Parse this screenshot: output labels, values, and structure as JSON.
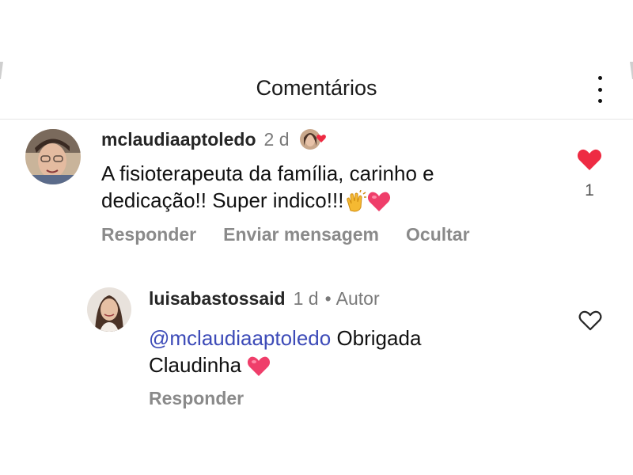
{
  "header": {
    "title": "Comentários",
    "more_icon": "more-vertical-icon"
  },
  "comments": [
    {
      "username": "mclaudiaaptoledo",
      "time": "2 d",
      "text_line1": "A fisioterapeuta da família, carinho e",
      "text_line2": "dedicação!! Super indico!!!",
      "like_count": "1",
      "liked": true,
      "actions": [
        "Responder",
        "Enviar mensagem",
        "Ocultar"
      ],
      "like_icon": "heart-filled-icon"
    }
  ],
  "reply": {
    "username": "luisabastossaid",
    "time": "1 d",
    "separator": "•",
    "badge": "Autor",
    "mention": "@mclaudiaaptoledo",
    "text_line1_rest": " Obrigada",
    "text_line2": "Claudinha",
    "actions": [
      "Responder"
    ],
    "liked": false,
    "like_icon": "heart-outline-icon"
  },
  "colors": {
    "like_red": "#ee2b43",
    "mention_blue": "#3d4bb8",
    "muted_gray": "#8a8a8a"
  }
}
